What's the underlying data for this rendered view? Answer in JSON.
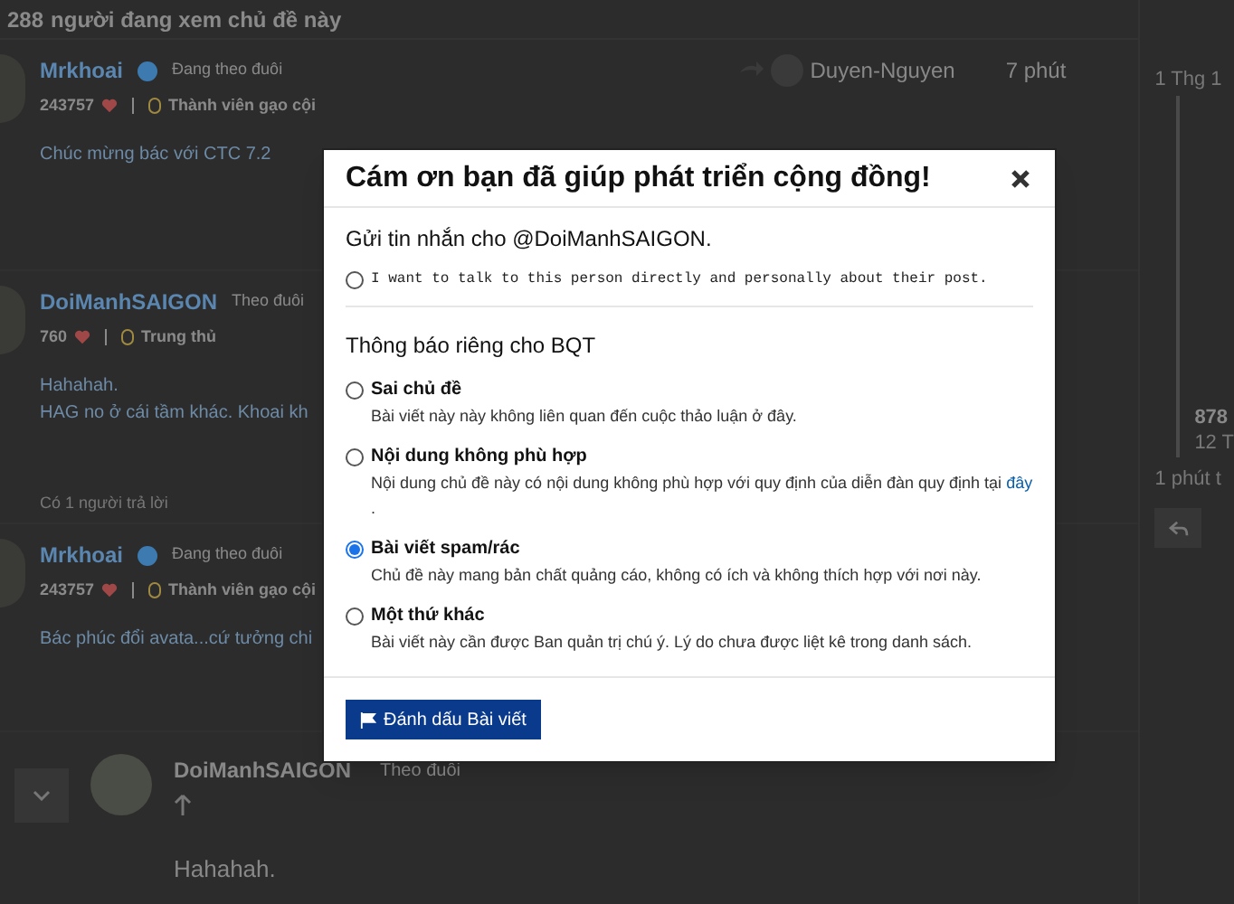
{
  "topic_bar": {
    "count": "288",
    "text": "người đang xem chủ đề này"
  },
  "posts": [
    {
      "author": "Mrkhoai",
      "verified": true,
      "follow": "Đang theo đuôi",
      "score": "243757",
      "rank": "Thành viên gạo cội",
      "reply_to": "Duyen-Nguyen",
      "time": "7 phút",
      "lines": [
        "Chúc mừng bác với CTC 7.2"
      ]
    },
    {
      "author": "DoiManhSAIGON",
      "verified": false,
      "follow": "Theo đuôi",
      "score": "760",
      "rank": "Trung thủ",
      "lines": [
        "Hahahah.",
        "HAG no ở cái tầm khác. Khoai kh"
      ],
      "replies": "Có 1 người trả lời"
    },
    {
      "author": "Mrkhoai",
      "verified": true,
      "follow": "Đang theo đuôi",
      "score": "243757",
      "rank": "Thành viên gạo cội",
      "lines": [
        "Bác phúc đổi avata...cứ tưởng chi"
      ]
    }
  ],
  "nested_post": {
    "author": "DoiManhSAIGON",
    "follow": "Theo đuôi",
    "lines": [
      "Hahahah."
    ]
  },
  "timeline": {
    "start": "1 Thg 1",
    "current": "878",
    "current_date": "12 T",
    "end": "1 phút t"
  },
  "modal": {
    "title": "Cám ơn bạn đã giúp phát triển cộng đồng!",
    "message_heading": "Gửi tin nhắn cho @DoiManhSAIGON.",
    "message_option": {
      "label": "I want to talk to this person directly and personally about their post.",
      "selected": false
    },
    "staff_heading": "Thông báo riêng cho BQT",
    "options": [
      {
        "label": "Sai chủ đề",
        "description": "Bài viết này này không liên quan đến cuộc thảo luận ở đây.",
        "selected": false
      },
      {
        "label": "Nội dung không phù hợp",
        "description": "Nội dung chủ đề này có nội dung không phù hợp với quy định của diễn đàn quy định tại",
        "link": "đây",
        "after": ".",
        "selected": false
      },
      {
        "label": "Bài viết spam/rác",
        "description": "Chủ đề này mang bản chất quảng cáo, không có ích và không thích hợp với nơi này.",
        "selected": true
      },
      {
        "label": "Một thứ khác",
        "description": "Bài viết này cần được Ban quản trị chú ý. Lý do chưa được liệt kê trong danh sách.",
        "selected": false
      }
    ],
    "submit": "Đánh dấu Bài viết"
  }
}
